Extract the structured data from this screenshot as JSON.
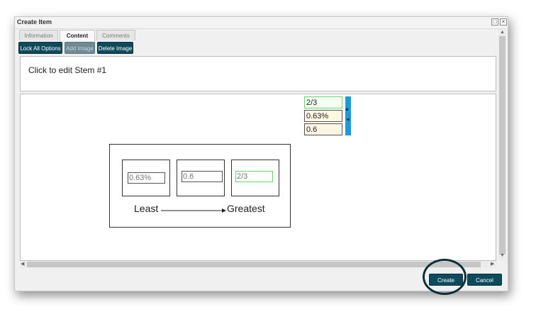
{
  "window": {
    "title": "Create Item",
    "maximize_glyph": "□",
    "close_glyph": "×"
  },
  "tabs": [
    {
      "label": "Information"
    },
    {
      "label": "Content"
    },
    {
      "label": "Comments"
    }
  ],
  "toolbar": {
    "lock_all_options": "Lock All Options",
    "add_image": "Add Image",
    "delete_image": "Delete Image"
  },
  "stem": {
    "text": "Click to edit Stem #1"
  },
  "drag_items": [
    {
      "value": "2/3"
    },
    {
      "value": "0.63%"
    },
    {
      "value": "0.6"
    }
  ],
  "order_panel": {
    "slots": [
      {
        "value": "0.63%"
      },
      {
        "value": "0.6"
      },
      {
        "value": "2/3"
      }
    ],
    "least_label": "Least",
    "greatest_label": "Greatest"
  },
  "footer": {
    "create": "Create",
    "cancel": "Cancel"
  },
  "colors": {
    "button_bg": "#0f4a5c",
    "handle_blue": "#1e9ad6",
    "selected_green": "#6bd46b"
  }
}
